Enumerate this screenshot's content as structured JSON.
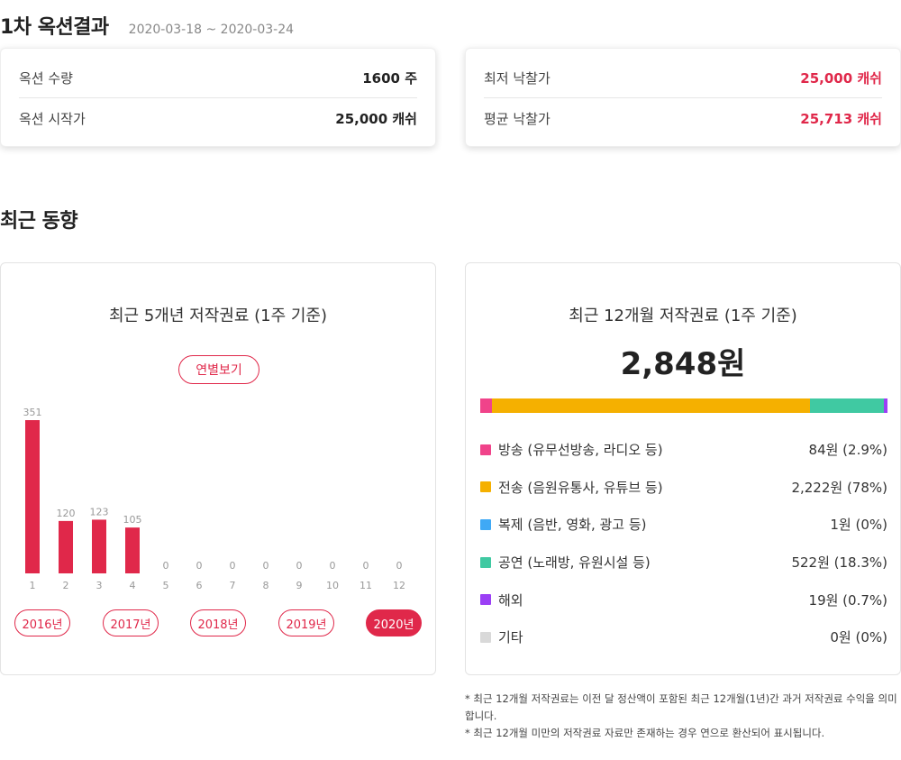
{
  "auction": {
    "title": "1차 옥션결과",
    "period": "2020-03-18 ~ 2020-03-24",
    "left_stats": [
      {
        "label": "옥션 수량",
        "value": "1600 주"
      },
      {
        "label": "옥션 시작가",
        "value": "25,000 캐쉬"
      }
    ],
    "right_stats": [
      {
        "label": "최저 낙찰가",
        "value": "25,000 캐쉬"
      },
      {
        "label": "평균 낙찰가",
        "value": "25,713 캐쉬"
      }
    ]
  },
  "trend": {
    "section_title": "최근 동향",
    "five_year": {
      "heading": "최근 5개년 저작권료 (1주 기준)",
      "yearly_button": "연별보기",
      "year_tabs": [
        "2016년",
        "2017년",
        "2018년",
        "2019년",
        "2020년"
      ],
      "active_year": "2020년"
    },
    "twelve_month": {
      "heading": "최근 12개월 저작권료 (1주 기준)",
      "total": "2,848원",
      "breakdown": [
        {
          "label": "방송 (유무선방송, 라디오 등)",
          "value": "84원 (2.9%)",
          "percent": 2.9,
          "color": "#f0438a"
        },
        {
          "label": "전송 (음원유통사, 유튜브 등)",
          "value": "2,222원 (78%)",
          "percent": 78,
          "color": "#f5b000"
        },
        {
          "label": "복제 (음반, 영화, 광고 등)",
          "value": "1원 (0%)",
          "percent": 0,
          "color": "#3fa9f5"
        },
        {
          "label": "공연 (노래방, 유원시설 등)",
          "value": "522원 (18.3%)",
          "percent": 18.3,
          "color": "#40c9a2"
        },
        {
          "label": "해외",
          "value": "19원 (0.7%)",
          "percent": 0.7,
          "color": "#9b3ff5"
        },
        {
          "label": "기타",
          "value": "0원 (0%)",
          "percent": 0,
          "color": "#d9d9d9"
        }
      ]
    },
    "footnotes": [
      "* 최근 12개월 저작권료는 이전 달 정산액이 포함된 최근 12개월(1년)간 과거 저작권료 수익을 의미합니다.",
      "* 최근 12개월 미만의 저작권료 자료만 존재하는 경우 연으로 환산되어 표시됩니다."
    ]
  },
  "chart_data": {
    "type": "bar",
    "categories": [
      "1",
      "2",
      "3",
      "4",
      "5",
      "6",
      "7",
      "8",
      "9",
      "10",
      "11",
      "12"
    ],
    "values": [
      351,
      120,
      123,
      105,
      0,
      0,
      0,
      0,
      0,
      0,
      0,
      0
    ],
    "ylim": [
      0,
      351
    ],
    "grid": false,
    "bar_color": "#e0284a",
    "label_color": "#999999"
  }
}
